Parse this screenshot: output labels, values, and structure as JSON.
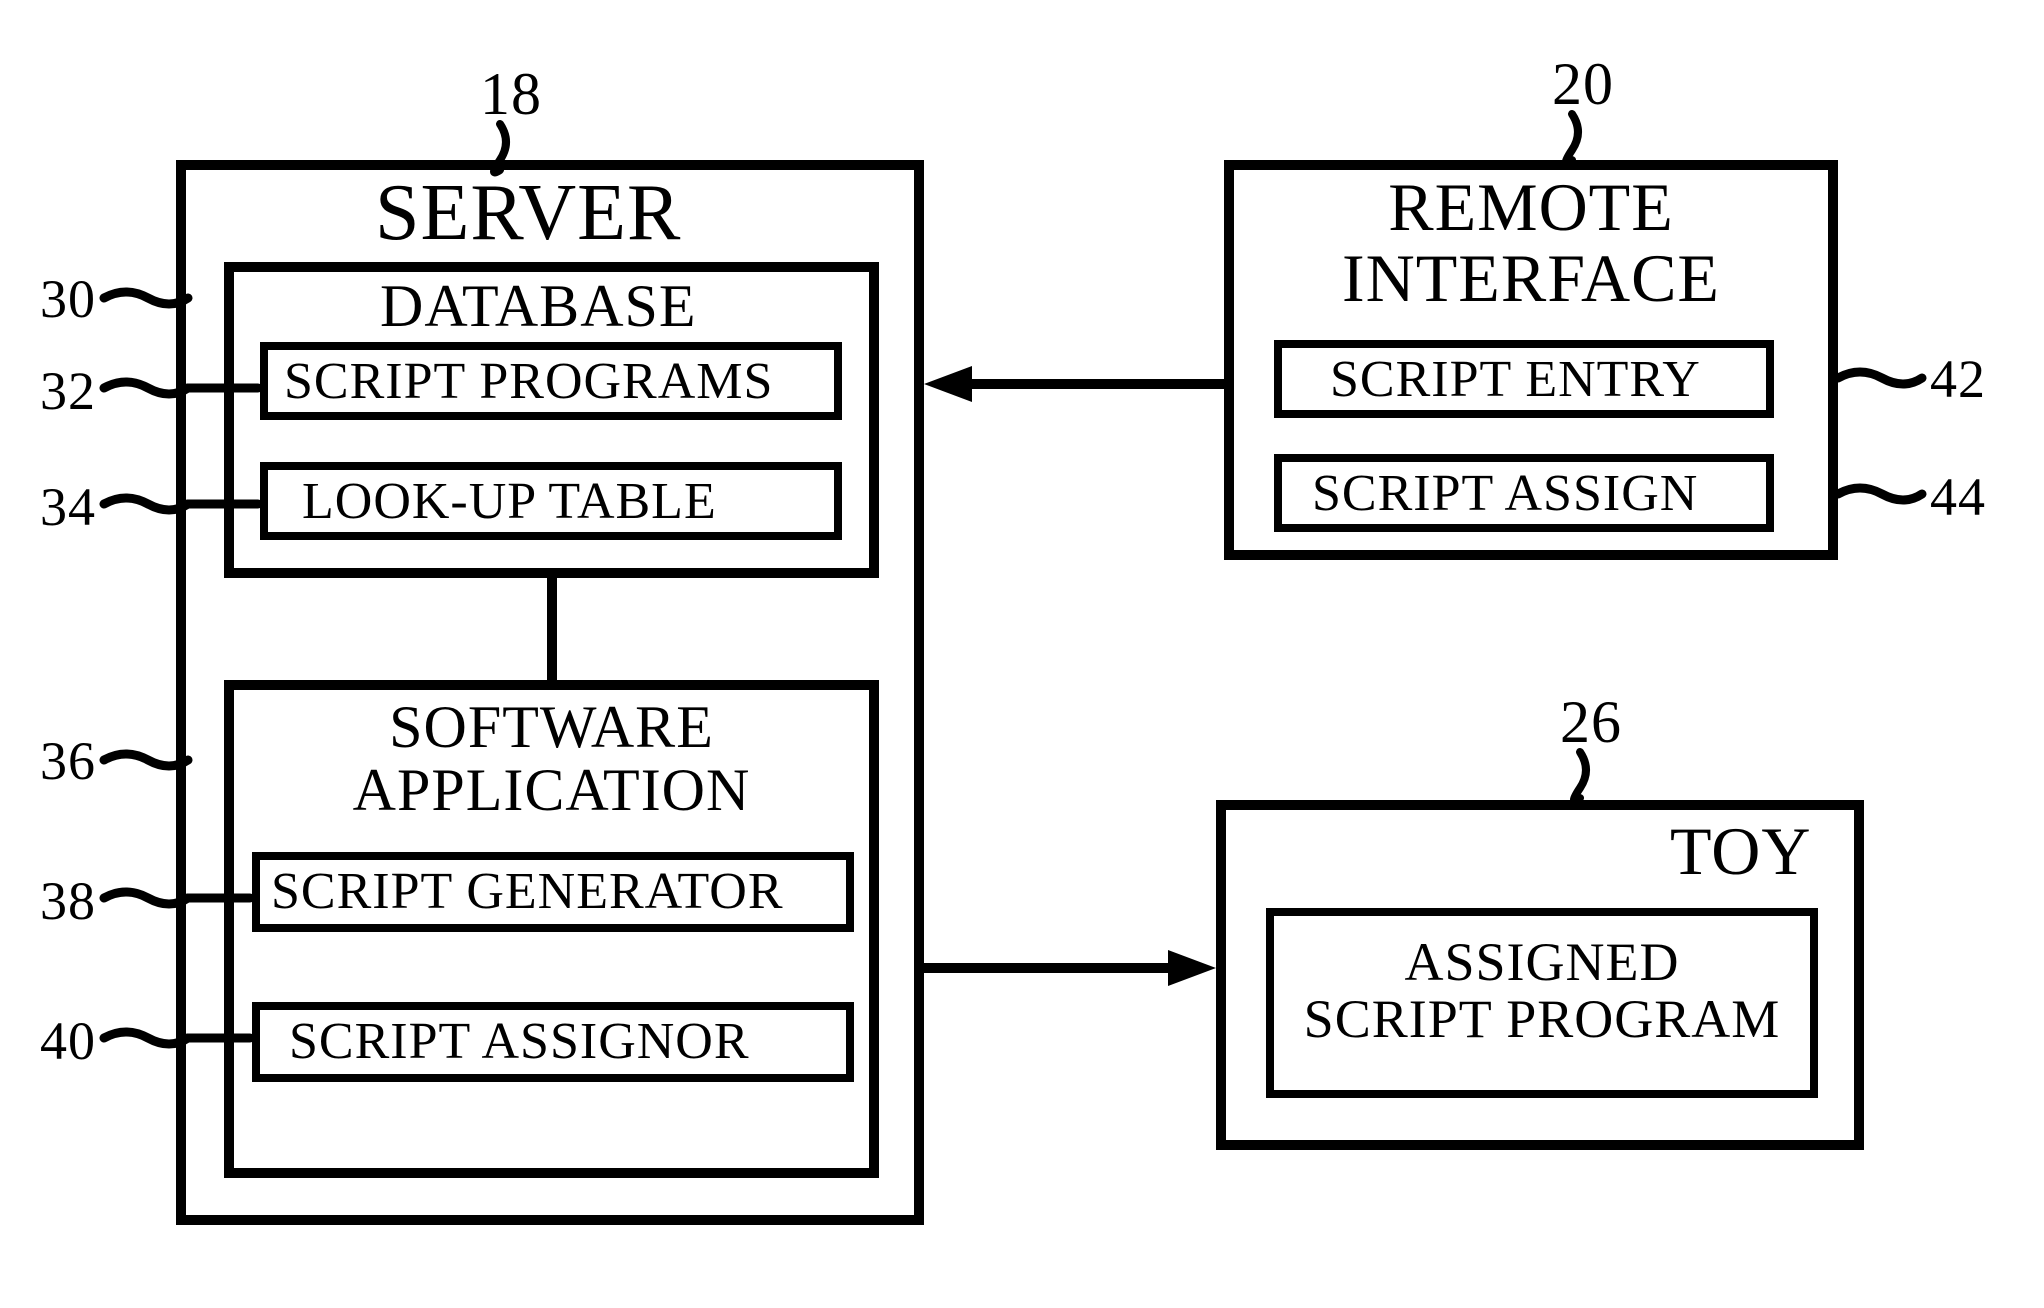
{
  "refs": {
    "server": "18",
    "remote": "20",
    "toy": "26",
    "database": "30",
    "script_programs": "32",
    "lookup_table": "34",
    "software_app": "36",
    "script_generator": "38",
    "script_assignor": "40",
    "script_entry": "42",
    "script_assign": "44"
  },
  "titles": {
    "server": "SERVER",
    "database": "DATABASE",
    "script_programs": "SCRIPT PROGRAMS",
    "lookup_table": "LOOK-UP TABLE",
    "software_app": "SOFTWARE\nAPPLICATION",
    "script_generator": "SCRIPT GENERATOR",
    "script_assignor": "SCRIPT ASSIGNOR",
    "remote_interface": "REMOTE\nINTERFACE",
    "script_entry": "SCRIPT ENTRY",
    "script_assign": "SCRIPT ASSIGN",
    "toy": "TOY",
    "assigned_script": "ASSIGNED\nSCRIPT PROGRAM"
  }
}
